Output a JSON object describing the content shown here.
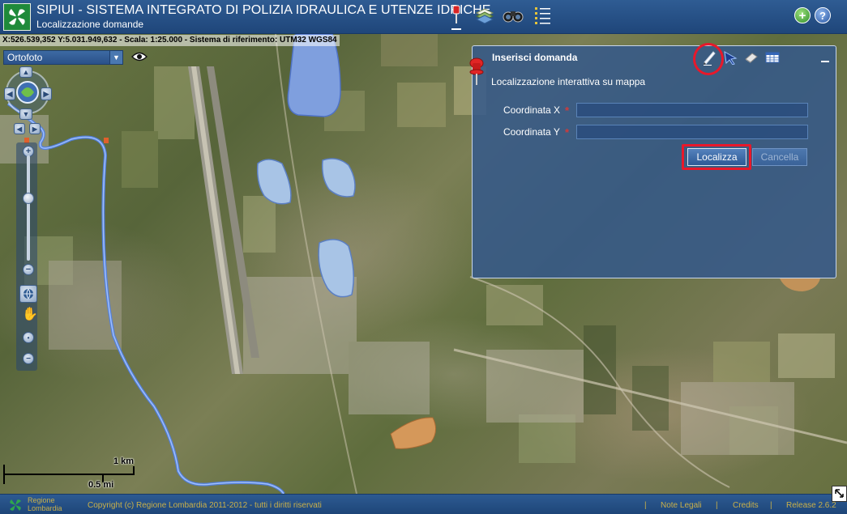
{
  "header": {
    "title": "SIPIUI - SISTEMA INTEGRATO DI POLIZIA IDRAULICA E UTENZE IDRICHE",
    "subtitle": "Localizzazione domande",
    "tools": [
      "pin-tool-icon",
      "layers-tool-icon",
      "binoculars-tool-icon",
      "list-tool-icon"
    ],
    "right_buttons": [
      "add-icon",
      "help-icon"
    ]
  },
  "coord_bar": {
    "text": "X:526.539,352 Y:5.031.949,632 - Scala: 1:25.000 - Sistema di riferimento: UTM32 WGS84"
  },
  "layer_select": {
    "value": "Ortofoto"
  },
  "scale": {
    "km": "1 km",
    "mi": "0.5 mi"
  },
  "dialog": {
    "title": "Inserisci domanda",
    "subtitle": "Localizzazione interattiva su mappa",
    "fields": [
      {
        "label": "Coordinata X",
        "value": ""
      },
      {
        "label": "Coordinata Y",
        "value": ""
      }
    ],
    "buttons": {
      "localize": "Localizza",
      "cancel": "Cancella"
    },
    "tools": [
      "pencil-icon",
      "pointer-icon",
      "eraser-icon",
      "table-icon"
    ]
  },
  "footer": {
    "region_line1": "Regione",
    "region_line2": "Lombardia",
    "copyright": "Copyright (c) Regione Lombardia 2011-2012 - tutti i diritti riservati",
    "links": {
      "legal": "Note Legali",
      "credits": "Credits"
    },
    "release": "Release 2.6.2"
  },
  "colors": {
    "header": "#2f5c93",
    "dialog": "#34588a",
    "highlight": "#e8182a",
    "footer_text": "#c9b04a",
    "lake": "#8aa9d8",
    "orange_area": "#d5985a"
  }
}
